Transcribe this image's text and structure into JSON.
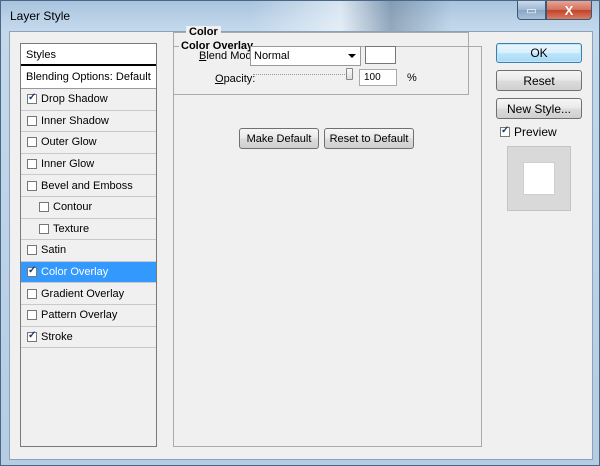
{
  "window": {
    "title": "Layer Style",
    "help_label": "▭",
    "close_label": "X"
  },
  "styles_list": {
    "header": "Styles",
    "blending_options": "Blending Options: Default",
    "items": [
      {
        "label": "Drop Shadow",
        "checked": true,
        "sub": false,
        "selected": false
      },
      {
        "label": "Inner Shadow",
        "checked": false,
        "sub": false,
        "selected": false
      },
      {
        "label": "Outer Glow",
        "checked": false,
        "sub": false,
        "selected": false
      },
      {
        "label": "Inner Glow",
        "checked": false,
        "sub": false,
        "selected": false
      },
      {
        "label": "Bevel and Emboss",
        "checked": false,
        "sub": false,
        "selected": false
      },
      {
        "label": "Contour",
        "checked": false,
        "sub": true,
        "selected": false
      },
      {
        "label": "Texture",
        "checked": false,
        "sub": true,
        "selected": false
      },
      {
        "label": "Satin",
        "checked": false,
        "sub": false,
        "selected": false
      },
      {
        "label": "Color Overlay",
        "checked": true,
        "sub": false,
        "selected": true
      },
      {
        "label": "Gradient Overlay",
        "checked": false,
        "sub": false,
        "selected": false
      },
      {
        "label": "Pattern Overlay",
        "checked": false,
        "sub": false,
        "selected": false
      },
      {
        "label": "Stroke",
        "checked": true,
        "sub": false,
        "selected": false
      }
    ]
  },
  "color_overlay": {
    "section_title": "Color Overlay",
    "group_title": "Color",
    "blend_mode_label": "Blend Mode:",
    "blend_mode_value": "Normal",
    "overlay_color": "#ffffff",
    "opacity_label": "Opacity:",
    "opacity_value": "100",
    "opacity_unit": "%",
    "make_default": "Make Default",
    "reset_to_default": "Reset to Default"
  },
  "actions": {
    "ok": "OK",
    "reset": "Reset",
    "new_style": "New Style...",
    "preview_label": "Preview",
    "preview_checked": true
  },
  "colors": {
    "selected_row": "#3399ff",
    "panel_bg": "#f0f0f0"
  }
}
